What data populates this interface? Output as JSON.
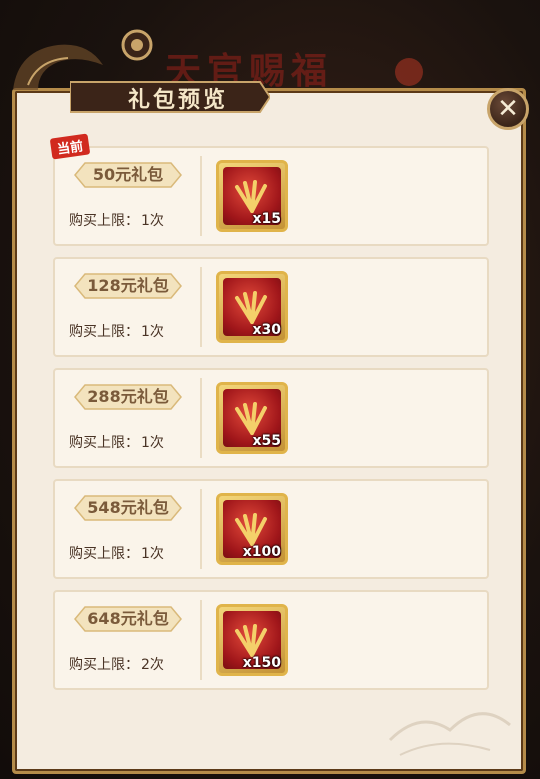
{
  "background": {
    "title": "天官赐福"
  },
  "dialog": {
    "title": "礼包预览",
    "close_icon": "close-icon"
  },
  "current_badge": "当前",
  "limit_label": "购买上限：",
  "packs": [
    {
      "name": "50元礼包",
      "limit": "1次",
      "quantity": "x15",
      "current": true
    },
    {
      "name": "128元礼包",
      "limit": "1次",
      "quantity": "x30",
      "current": false
    },
    {
      "name": "288元礼包",
      "limit": "1次",
      "quantity": "x55",
      "current": false
    },
    {
      "name": "548元礼包",
      "limit": "1次",
      "quantity": "x100",
      "current": false
    },
    {
      "name": "648元礼包",
      "limit": "2次",
      "quantity": "x150",
      "current": false
    }
  ],
  "colors": {
    "accent_gold": "#c8a46a",
    "panel_bg": "#f4ece0",
    "badge_red": "#d12a1f",
    "item_red": "#a0161a"
  }
}
